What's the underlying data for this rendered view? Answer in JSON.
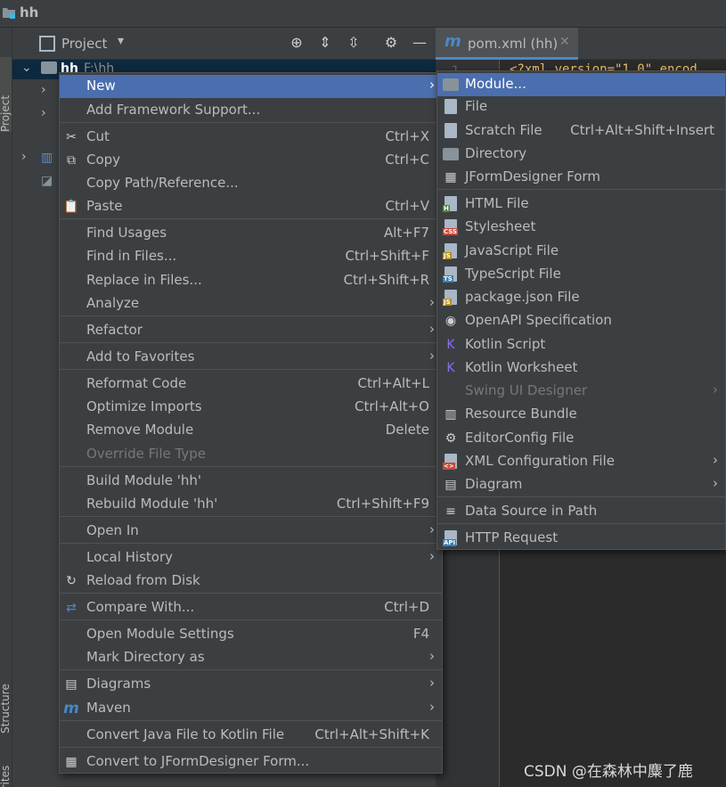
{
  "app": {
    "title": "hh"
  },
  "side_tabs": {
    "project": "Project",
    "structure": "Structure",
    "favorites": "Favorites"
  },
  "project_panel": {
    "title": "Project",
    "root_name": "hh",
    "root_path": "F:\\hh"
  },
  "editor": {
    "tab_label": "pom.xml (hh)",
    "tab_icon": "m",
    "line_number": "1",
    "code_line": "<?xml version=\"1.0\" encod"
  },
  "context_menu": {
    "items": [
      {
        "label": "New",
        "arrow": "›"
      },
      {
        "label": "Add Framework Support..."
      },
      {
        "label": "Cut",
        "shortcut": "Ctrl+X",
        "icon": "scissors-icon"
      },
      {
        "label": "Copy",
        "shortcut": "Ctrl+C",
        "icon": "copy-icon"
      },
      {
        "label": "Copy Path/Reference..."
      },
      {
        "label": "Paste",
        "shortcut": "Ctrl+V",
        "icon": "clipboard-icon"
      },
      {
        "label": "Find Usages",
        "shortcut": "Alt+F7"
      },
      {
        "label": "Find in Files...",
        "shortcut": "Ctrl+Shift+F"
      },
      {
        "label": "Replace in Files...",
        "shortcut": "Ctrl+Shift+R"
      },
      {
        "label": "Analyze",
        "arrow": "›"
      },
      {
        "label": "Refactor",
        "arrow": "›"
      },
      {
        "label": "Add to Favorites",
        "arrow": "›"
      },
      {
        "label": "Reformat Code",
        "shortcut": "Ctrl+Alt+L"
      },
      {
        "label": "Optimize Imports",
        "shortcut": "Ctrl+Alt+O"
      },
      {
        "label": "Remove Module",
        "shortcut": "Delete"
      },
      {
        "label": "Override File Type"
      },
      {
        "label": "Build Module 'hh'"
      },
      {
        "label": "Rebuild Module 'hh'",
        "shortcut": "Ctrl+Shift+F9"
      },
      {
        "label": "Open In",
        "arrow": "›"
      },
      {
        "label": "Local History",
        "arrow": "›"
      },
      {
        "label": "Reload from Disk",
        "icon": "reload-icon"
      },
      {
        "label": "Compare With...",
        "shortcut": "Ctrl+D",
        "icon": "compare-icon"
      },
      {
        "label": "Open Module Settings",
        "shortcut": "F4"
      },
      {
        "label": "Mark Directory as",
        "arrow": "›"
      },
      {
        "label": "Diagrams",
        "arrow": "›",
        "icon": "diagram-icon"
      },
      {
        "label": "Maven",
        "arrow": "›",
        "icon": "maven-icon"
      },
      {
        "label": "Convert Java File to Kotlin File",
        "shortcut": "Ctrl+Alt+Shift+K"
      },
      {
        "label": "Convert to JFormDesigner Form...",
        "icon": "jformdesigner-icon"
      }
    ]
  },
  "submenu": {
    "items": [
      {
        "label": "Module...",
        "icon": "module-folder-icon"
      },
      {
        "label": "File",
        "icon": "file-icon"
      },
      {
        "label": "Scratch File",
        "shortcut": "Ctrl+Alt+Shift+Insert",
        "icon": "scratch-file-icon"
      },
      {
        "label": "Directory",
        "icon": "folder-icon"
      },
      {
        "label": "JFormDesigner Form",
        "icon": "jformdesigner-icon"
      },
      {
        "label": "HTML File",
        "icon": "html-file-icon",
        "badge": "H"
      },
      {
        "label": "Stylesheet",
        "icon": "css-file-icon",
        "badge": "CSS"
      },
      {
        "label": "JavaScript File",
        "icon": "js-file-icon",
        "badge": "JS"
      },
      {
        "label": "TypeScript File",
        "icon": "ts-file-icon",
        "badge": "TS"
      },
      {
        "label": "package.json File",
        "icon": "nodejs-icon",
        "badge": "JS"
      },
      {
        "label": "OpenAPI Specification",
        "icon": "openapi-icon"
      },
      {
        "label": "Kotlin Script",
        "icon": "kotlin-script-icon"
      },
      {
        "label": "Kotlin Worksheet",
        "icon": "kotlin-worksheet-icon"
      },
      {
        "label": "Swing UI Designer",
        "arrow": "›"
      },
      {
        "label": "Resource Bundle",
        "icon": "resource-bundle-icon"
      },
      {
        "label": "EditorConfig File",
        "icon": "gear-icon"
      },
      {
        "label": "XML Configuration File",
        "arrow": "›",
        "icon": "xml-file-icon",
        "badge": "<>"
      },
      {
        "label": "Diagram",
        "arrow": "›",
        "icon": "diagram-icon"
      },
      {
        "label": "Data Source in Path",
        "icon": "database-icon"
      },
      {
        "label": "HTTP Request",
        "icon": "api-file-icon",
        "badge": "API"
      }
    ]
  },
  "watermark": "CSDN @在森林中麋了鹿",
  "colors": {
    "selection": "#4b6eaf",
    "menu_bg": "#3c3f41",
    "editor_bg": "#2b2b2b",
    "text": "#bbbbbb",
    "disabled": "#777777"
  }
}
